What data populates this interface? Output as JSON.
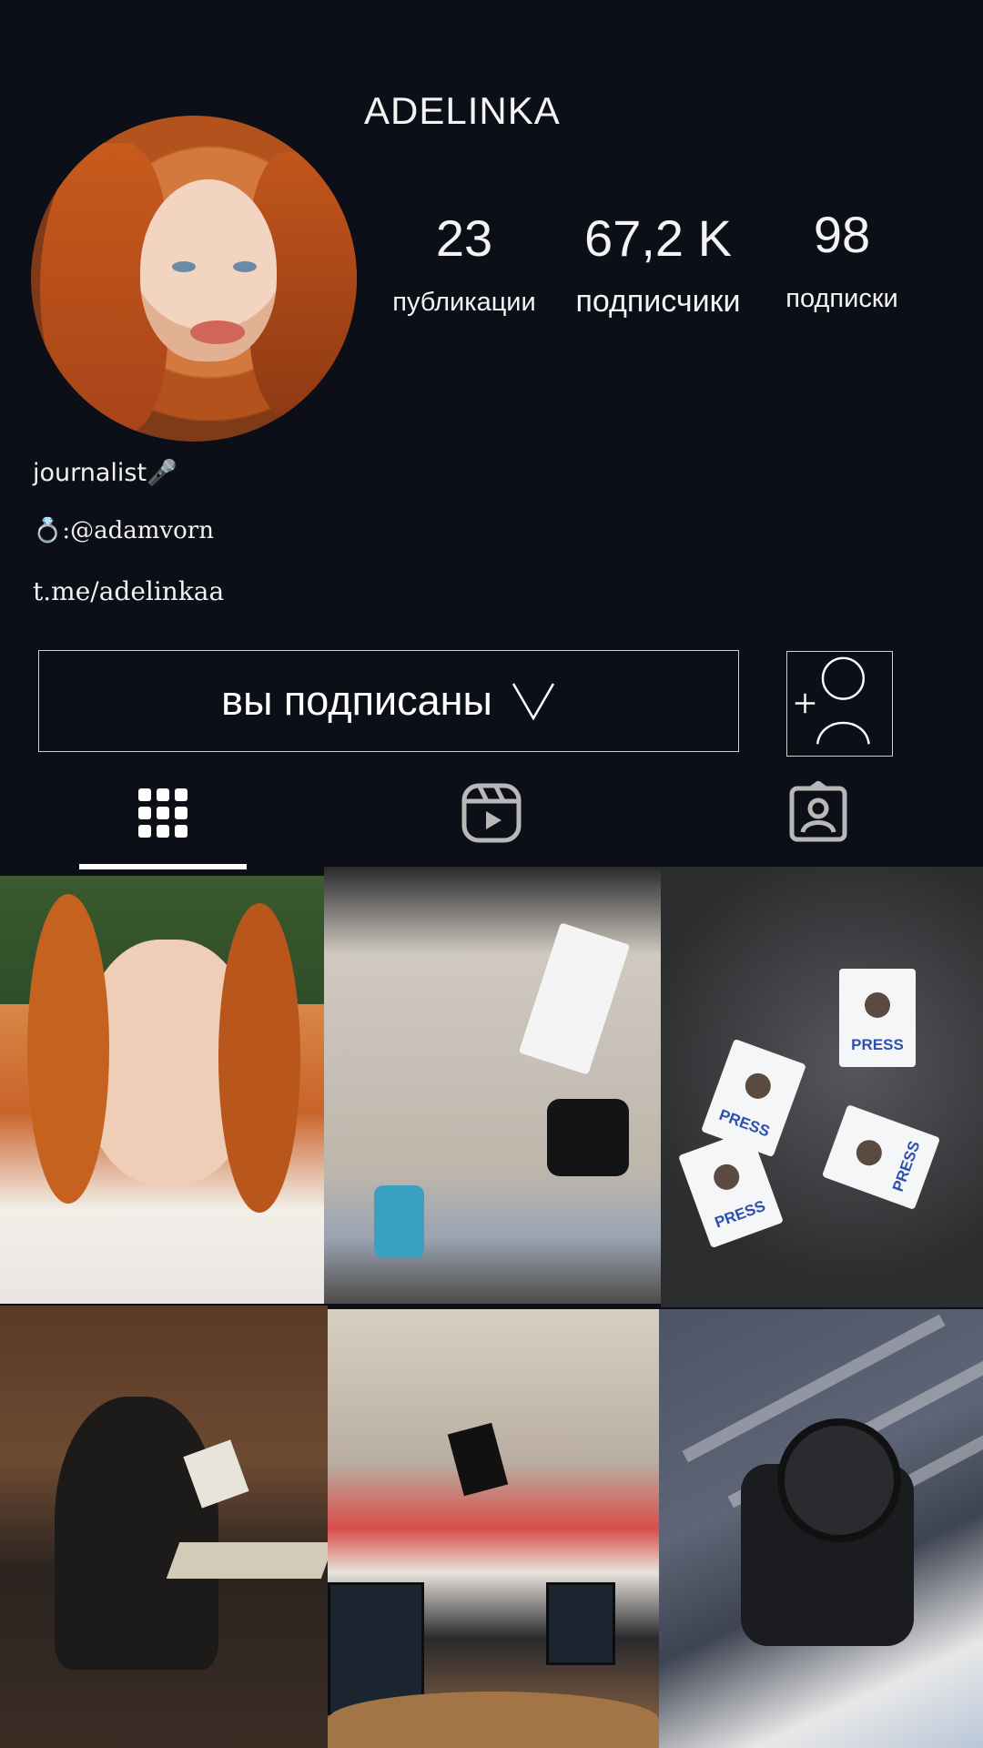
{
  "profile": {
    "username": "ADELINKA",
    "stats": {
      "posts": {
        "value": "23",
        "label": "публикации"
      },
      "followers": {
        "value": "67,2 K",
        "label": "подписчики"
      },
      "following": {
        "value": "98",
        "label": "подписки"
      }
    },
    "bio": {
      "line1": "journalist🎤",
      "line2": "💍:@adamvorn",
      "line3": "t.me/adelinkaa"
    }
  },
  "actions": {
    "follow_label": "вы подписаны"
  },
  "tabs": [
    {
      "name": "grid",
      "icon": "grid-icon",
      "active": true
    },
    {
      "name": "reels",
      "icon": "reels-icon",
      "active": false
    },
    {
      "name": "tagged",
      "icon": "tagged-user-icon",
      "active": false
    }
  ],
  "photos": {
    "press_badge_text": "PRESS"
  },
  "colors": {
    "background": "#0c0f17",
    "text": "#f4f4f4",
    "border": "#cfcfcf"
  }
}
